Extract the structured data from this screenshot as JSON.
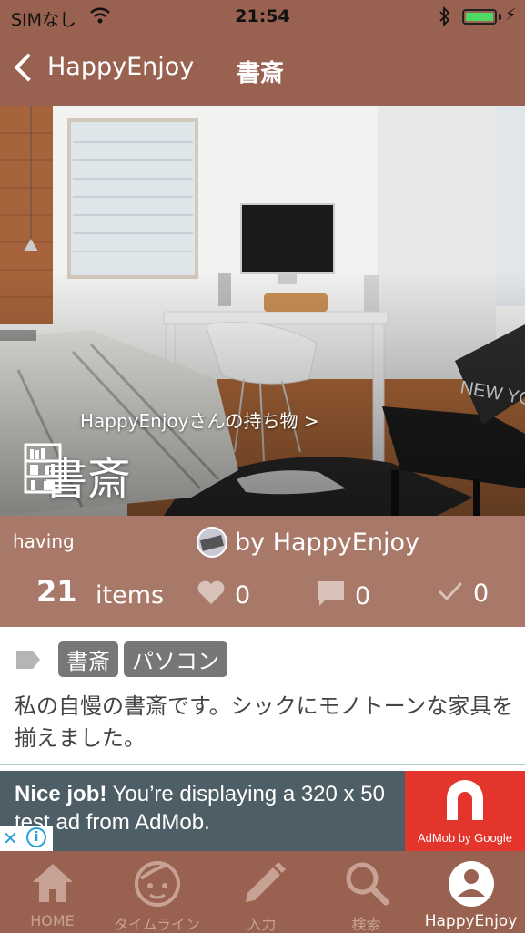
{
  "status_bar": {
    "carrier": "SIMなし",
    "time": "21:54",
    "wifi_icon": "wifi-icon",
    "bluetooth_icon": "bluetooth-icon",
    "battery_level": 1.0
  },
  "nav": {
    "back_label": "HappyEnjoy",
    "title": "書斎"
  },
  "hero": {
    "owner_link": "HappyEnjoyさんの持ち物 >",
    "title": "書斎",
    "category_icon": "bookshelf-icon"
  },
  "stats": {
    "having_label": "having",
    "author": "by HappyEnjoy",
    "item_count": "21",
    "item_unit": "items",
    "likes": "0",
    "comments": "0",
    "checks": "0"
  },
  "tags": {
    "items": [
      "書斎",
      "パソコン"
    ]
  },
  "description": "私の自慢の書斎です。シックにモノトーンな家具を揃えました。",
  "ad": {
    "headline": "Nice job!",
    "body": "You’re displaying a 320 x 50 test ad from AdMob.",
    "brand": "AdMob by Google"
  },
  "tab_bar": {
    "tabs": [
      {
        "label": "HOME",
        "icon": "home-icon"
      },
      {
        "label": "タイムライン",
        "icon": "face-icon"
      },
      {
        "label": "入力",
        "icon": "pencil-icon"
      },
      {
        "label": "検索",
        "icon": "search-icon"
      },
      {
        "label": "HappyEnjoy",
        "icon": "profile-icon"
      }
    ],
    "active_index": 4
  },
  "colors": {
    "brand": "#99614f",
    "stats_bg": "#a87868",
    "tag_chip": "#777777",
    "ad_red": "#e3352c"
  }
}
